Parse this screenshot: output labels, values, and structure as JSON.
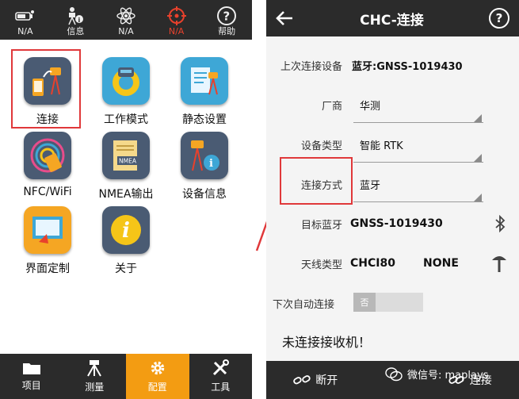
{
  "left": {
    "status_bar": [
      {
        "label": "N/A",
        "icon": "battery-usb-icon"
      },
      {
        "label": "信息",
        "icon": "surveyor-info-icon"
      },
      {
        "label": "N/A",
        "icon": "atom-icon"
      },
      {
        "label": "N/A",
        "icon": "crosshair-icon",
        "active": true
      },
      {
        "label": "帮助",
        "icon": "help-icon"
      }
    ],
    "apps": [
      {
        "label": "连接"
      },
      {
        "label": "工作模式"
      },
      {
        "label": "静态设置"
      },
      {
        "label": "NFC/WiFi"
      },
      {
        "label": "NMEA输出",
        "icon_text": "NMEA"
      },
      {
        "label": "设备信息"
      },
      {
        "label": "界面定制"
      },
      {
        "label": "关于"
      }
    ],
    "bottom_nav": [
      {
        "label": "项目"
      },
      {
        "label": "测量"
      },
      {
        "label": "配置",
        "active": true
      },
      {
        "label": "工具"
      }
    ]
  },
  "right": {
    "title": "CHC-连接",
    "help_label": "?",
    "rows": {
      "last_device": {
        "label": "上次连接设备",
        "value": "蓝牙:GNSS-1019430"
      },
      "manufacturer": {
        "label": "厂商",
        "value": "华测"
      },
      "device_type": {
        "label": "设备类型",
        "value": "智能 RTK"
      },
      "connect_mode": {
        "label": "连接方式",
        "value": "蓝牙"
      },
      "target_bt": {
        "label": "目标蓝牙",
        "value": "GNSS-1019430"
      },
      "antenna": {
        "label": "天线类型",
        "value": "CHCI80",
        "value2": "NONE"
      },
      "auto_connect": {
        "label": "下次自动连接",
        "toggle": "否"
      }
    },
    "status_message": "未连接接收机！",
    "buttons": {
      "disconnect": "断开",
      "connect": "连接"
    },
    "watermark": "微信号: maplays"
  },
  "colors": {
    "accent": "#f39c12",
    "highlight": "#e0383a",
    "dark": "#2b2b2b"
  }
}
